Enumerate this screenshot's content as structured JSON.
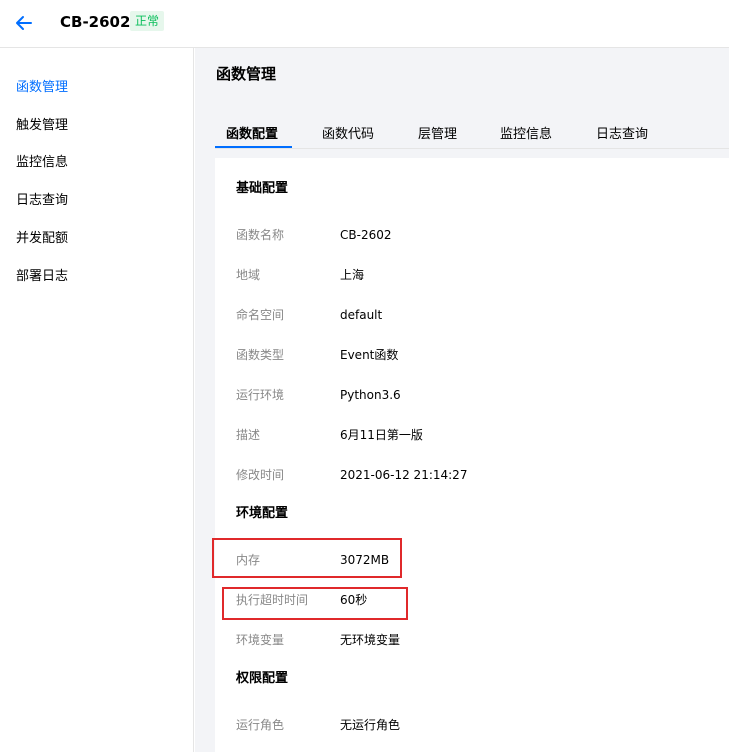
{
  "header": {
    "title": "CB-2602",
    "status": "正常",
    "colors": {
      "status_text": "#0abf5b",
      "status_bg": "#e6f7ec",
      "accent": "#006eff"
    }
  },
  "sidebar": {
    "items": [
      {
        "label": "函数管理",
        "active": true
      },
      {
        "label": "触发管理"
      },
      {
        "label": "监控信息"
      },
      {
        "label": "日志查询"
      },
      {
        "label": "并发配额"
      },
      {
        "label": "部署日志"
      }
    ]
  },
  "main": {
    "title": "函数管理",
    "tabs": [
      {
        "label": "函数配置",
        "active": true
      },
      {
        "label": "函数代码"
      },
      {
        "label": "层管理"
      },
      {
        "label": "监控信息"
      },
      {
        "label": "日志查询"
      }
    ]
  },
  "config": {
    "basic": {
      "title": "基础配置",
      "rows": [
        {
          "label": "函数名称",
          "value": "CB-2602"
        },
        {
          "label": "地域",
          "value": "上海"
        },
        {
          "label": "命名空间",
          "value": "default"
        },
        {
          "label": "函数类型",
          "value": "Event函数"
        },
        {
          "label": "运行环境",
          "value": "Python3.6"
        },
        {
          "label": "描述",
          "value": "6月11日第一版"
        },
        {
          "label": "修改时间",
          "value": "2021-06-12 21:14:27"
        }
      ]
    },
    "env": {
      "title": "环境配置",
      "rows": [
        {
          "label": "内存",
          "value": "3072MB",
          "highlighted": true
        },
        {
          "label": "执行超时时间",
          "value": "60秒",
          "highlighted": true
        },
        {
          "label": "环境变量",
          "value": "无环境变量"
        }
      ]
    },
    "perm": {
      "title": "权限配置",
      "rows": [
        {
          "label": "运行角色",
          "value": "无运行角色"
        }
      ]
    },
    "highlight_color": "#e0292b"
  }
}
